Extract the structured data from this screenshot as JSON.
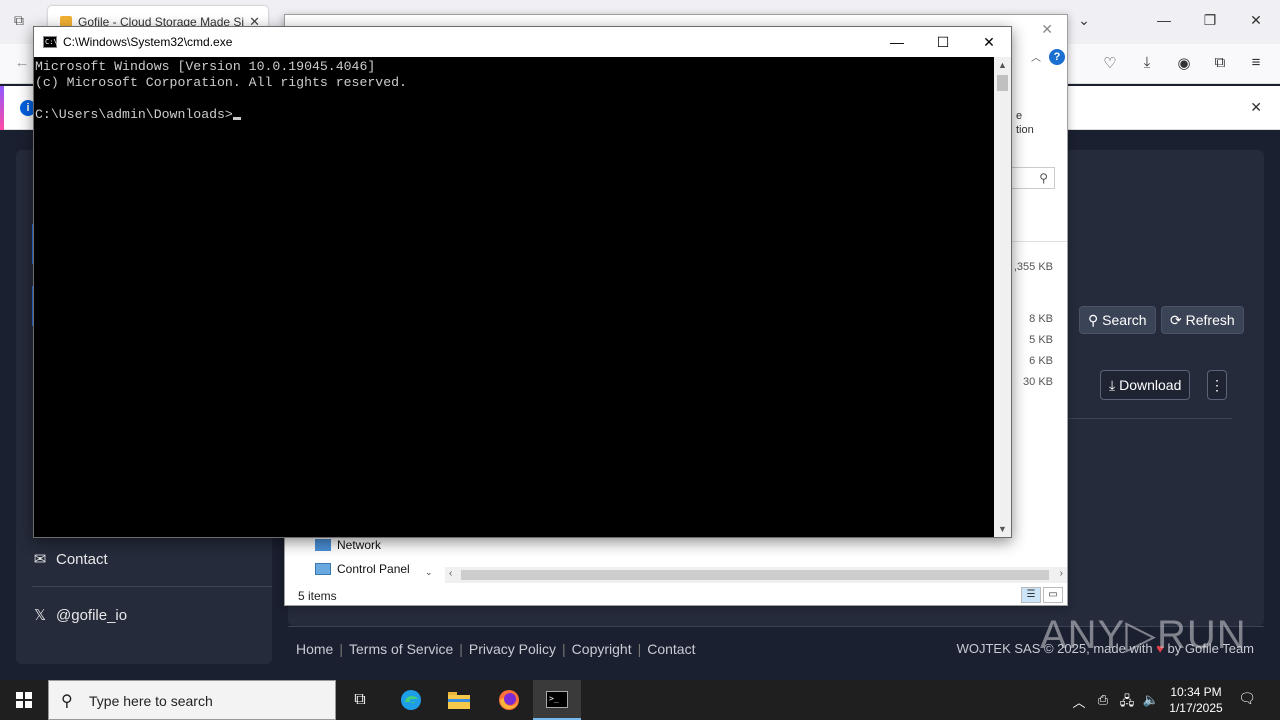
{
  "browser": {
    "tab_title": "Gofile - Cloud Storage Made Si",
    "notification_close": "✕"
  },
  "sidebar": {
    "contact": "Contact",
    "twitter": "@gofile_io"
  },
  "main": {
    "search_button": "Search",
    "refresh_button": "Refresh",
    "download_button": "Download"
  },
  "footer": {
    "links": [
      "Home",
      "Terms of Service",
      "Privacy Policy",
      "Copyright",
      "Contact"
    ],
    "copyright": "WOJTEK SAS © 2025, made with",
    "copyright_by": "by Gofile Team"
  },
  "explorer": {
    "ribbon_text": "e\ntion",
    "sizes": [
      ",355 KB",
      "8 KB",
      "5 KB",
      "6 KB",
      "30 KB"
    ],
    "nav_items": [
      "Network",
      "Control Panel"
    ],
    "status": "5 items"
  },
  "cmd": {
    "title": "C:\\Windows\\System32\\cmd.exe",
    "lines": [
      "Microsoft Windows [Version 10.0.19045.4046]",
      "(c) Microsoft Corporation. All rights reserved.",
      "",
      "C:\\Users\\admin\\Downloads>"
    ]
  },
  "taskbar": {
    "search_placeholder": "Type here to search",
    "time": "10:34 PM",
    "date": "1/17/2025"
  },
  "watermark": "ANY▷RUN",
  "colors": {
    "page_bg": "#1b2030",
    "panel_bg": "#252b3b",
    "accent": "#2f6fe0",
    "console_bg": "#000000",
    "console_fg": "#cccccc",
    "taskbar_bg": "#1f1f1f"
  },
  "icons": {
    "sidebar_contact": "envelope-icon",
    "sidebar_twitter": "x-logo-icon",
    "search": "search-icon",
    "refresh": "refresh-icon",
    "download": "download-icon",
    "more": "kebab-menu-icon"
  }
}
